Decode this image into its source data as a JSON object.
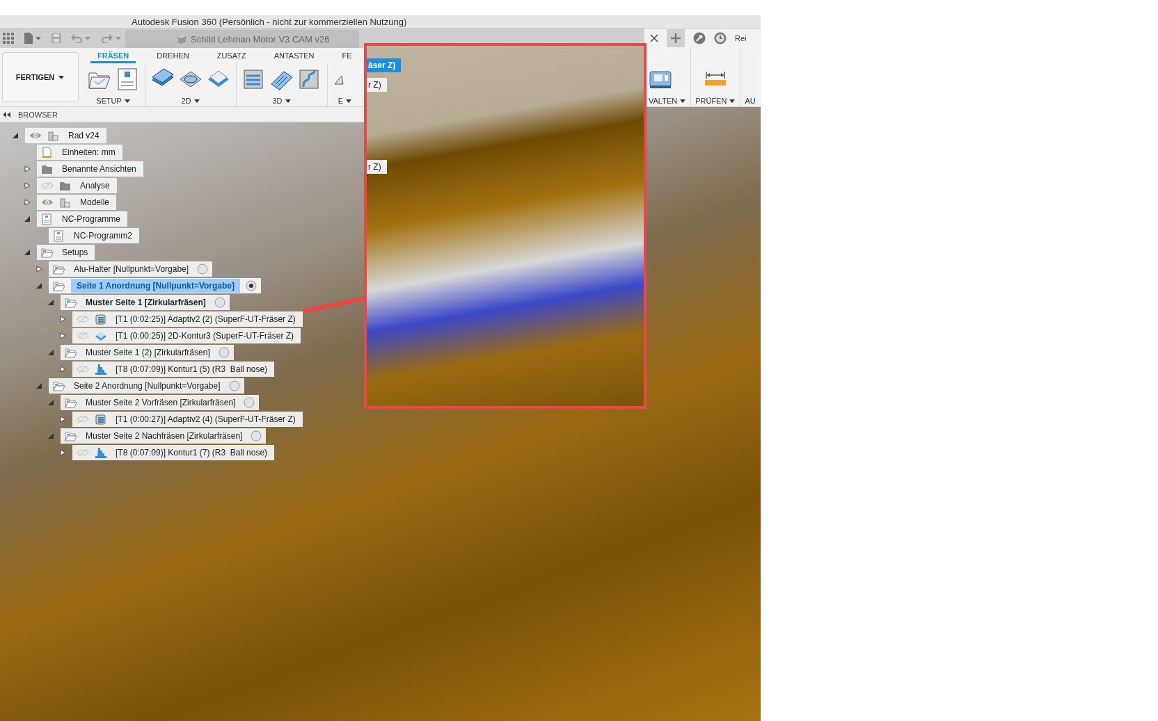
{
  "window": {
    "title": "Autodesk Fusion 360 (Persönlich - nicht zur kommerziellen Nutzung)"
  },
  "document_tab": {
    "title": "Schild Lehman Motor V3 CAM v26"
  },
  "tab_strip_right": {
    "text": "Rei"
  },
  "ribbon": {
    "workspace_button": "FERTIGEN",
    "tabs": [
      {
        "label": "FRÄSEN",
        "selected": true
      },
      {
        "label": "DREHEN",
        "selected": false
      },
      {
        "label": "ZUSATZ",
        "selected": false
      },
      {
        "label": "ANTASTEN",
        "selected": false
      },
      {
        "label": "FE",
        "selected": false
      }
    ],
    "groups_left": [
      {
        "label": "SETUP"
      },
      {
        "label": "2D"
      },
      {
        "label": "3D"
      },
      {
        "label": "E"
      }
    ],
    "groups_right": [
      {
        "label": "VALTEN"
      },
      {
        "label": "PRÜFEN"
      },
      {
        "label": "AU"
      }
    ]
  },
  "browser": {
    "title": "BROWSER",
    "tree": [
      {
        "label": "Rad v24",
        "kind": "component",
        "expanded": true,
        "visible": true,
        "selected": false,
        "emphasized": false,
        "children": [
          {
            "label": "Einheiten: mm",
            "kind": "units",
            "selected": false,
            "emphasized": false
          },
          {
            "label": "Benannte Ansichten",
            "kind": "folder",
            "expanded": false,
            "selected": false,
            "emphasized": false
          },
          {
            "label": "Analyse",
            "kind": "folder",
            "expanded": false,
            "visible": false,
            "selected": false,
            "emphasized": false
          },
          {
            "label": "Modelle",
            "kind": "component",
            "expanded": false,
            "visible": true,
            "selected": false,
            "emphasized": false
          },
          {
            "label": "NC-Programme",
            "kind": "nc-program",
            "expanded": true,
            "selected": false,
            "emphasized": false,
            "children": [
              {
                "label": "NC-Programm2",
                "kind": "nc-program",
                "selected": false,
                "emphasized": false
              }
            ]
          },
          {
            "label": "Setups",
            "kind": "setup",
            "expanded": true,
            "selected": false,
            "emphasized": false,
            "children": [
              {
                "label": "Alu-Halter [Nullpunkt=Vorgabe]",
                "kind": "setup",
                "expanded": false,
                "active": false,
                "selected": false,
                "emphasized": false
              },
              {
                "label": "Seite 1 Anordnung [Nullpunkt=Vorgabe]",
                "kind": "setup",
                "expanded": true,
                "active": true,
                "selected": true,
                "emphasized": true,
                "children": [
                  {
                    "label": "Muster Seite 1 [Zirkularfräsen]",
                    "kind": "setup",
                    "expanded": true,
                    "active": false,
                    "selected": false,
                    "emphasized": true,
                    "children": [
                      {
                        "label": "[T1 (0:02:25)] Adaptiv2 (2) (SuperF-UT-Fräser Z)",
                        "kind": "adaptive",
                        "expanded": false,
                        "visible": false,
                        "selected": false,
                        "emphasized": false
                      },
                      {
                        "label": "[T1 (0:00:25)] 2D-Kontur3 (SuperF-UT-Fräser Z)",
                        "kind": "contour-2d",
                        "expanded": false,
                        "visible": false,
                        "selected": false,
                        "emphasized": false
                      }
                    ]
                  },
                  {
                    "label": "Muster Seite 1 (2) [Zirkularfräsen]",
                    "kind": "setup",
                    "expanded": true,
                    "active": false,
                    "selected": false,
                    "emphasized": false,
                    "children": [
                      {
                        "label": "[T8 (0:07:09)] Kontur1 (5) (R3  Ball nose)",
                        "kind": "contour-3d",
                        "expanded": false,
                        "visible": false,
                        "selected": false,
                        "emphasized": false
                      }
                    ]
                  }
                ]
              },
              {
                "label": "Seite 2 Anordnung [Nullpunkt=Vorgabe]",
                "kind": "setup",
                "expanded": true,
                "active": false,
                "selected": false,
                "emphasized": false,
                "children": [
                  {
                    "label": "Muster Seite 2 Vorfräsen [Zirkularfräsen]",
                    "kind": "setup",
                    "expanded": true,
                    "active": false,
                    "selected": false,
                    "emphasized": false,
                    "children": [
                      {
                        "label": "[T1 (0:00:27)] Adaptiv2 (4) (SuperF-UT-Fräser Z)",
                        "kind": "adaptive",
                        "expanded": false,
                        "visible": false,
                        "selected": false,
                        "emphasized": false
                      }
                    ]
                  },
                  {
                    "label": "Muster Seite 2 Nachfräsen [Zirkularfräsen]",
                    "kind": "setup",
                    "expanded": true,
                    "active": false,
                    "selected": false,
                    "emphasized": false,
                    "children": [
                      {
                        "label": "[T8 (0:07:09)] Kontur1 (7) (R3  Ball nose)",
                        "kind": "contour-3d",
                        "expanded": false,
                        "visible": false,
                        "selected": false,
                        "emphasized": false
                      }
                    ]
                  }
                ]
              }
            ]
          }
        ]
      }
    ]
  },
  "inset": {
    "labels": [
      {
        "text": "äser Z)",
        "selected": true
      },
      {
        "text": "r Z)",
        "selected": false
      },
      {
        "text": "r Z)",
        "selected": false
      }
    ]
  }
}
